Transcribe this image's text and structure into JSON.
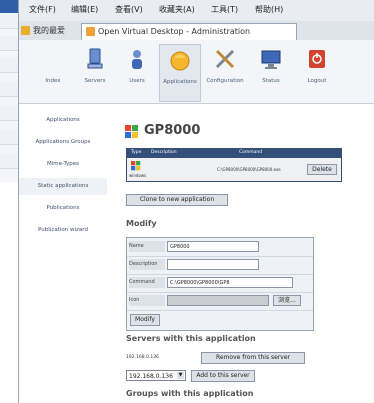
{
  "menubar": {
    "items": [
      "文件(F)",
      "编辑(E)",
      "查看(V)",
      "收藏夹(A)",
      "工具(T)",
      "帮助(H)"
    ]
  },
  "tabs": [
    {
      "label": "我的最爱",
      "active": false
    },
    {
      "label": "Open Virtual Desktop - Administration",
      "active": true
    }
  ],
  "nav": [
    {
      "label": "Index",
      "icon": "index-icon"
    },
    {
      "label": "Servers",
      "icon": "server-icon"
    },
    {
      "label": "Users",
      "icon": "users-icon"
    },
    {
      "label": "Applications",
      "icon": "applications-icon",
      "active": true
    },
    {
      "label": "Configuration",
      "icon": "tools-icon"
    },
    {
      "label": "Status",
      "icon": "monitor-icon"
    },
    {
      "label": "Logout",
      "icon": "logout-icon"
    }
  ],
  "sidebar": {
    "items": [
      {
        "label": "Applications"
      },
      {
        "label": "Applications Groups"
      },
      {
        "label": "Mime-Types"
      },
      {
        "label": "Static applications",
        "active": true
      },
      {
        "label": "Publications"
      },
      {
        "label": "Publication wizard"
      }
    ]
  },
  "app": {
    "title": "GP8000",
    "table": {
      "headers": [
        "Type",
        "Description",
        "Command"
      ],
      "row": {
        "type": "windows",
        "description": "",
        "command": "C:\\GP8000\\GP8000\\GP8000.exe"
      },
      "delete_label": "Delete"
    },
    "clone_label": "Clone to new application"
  },
  "modify": {
    "heading": "Modify",
    "fields": [
      {
        "label": "Name",
        "value": "GP8000"
      },
      {
        "label": "Description",
        "value": ""
      },
      {
        "label": "Command",
        "value": "C:\\GP8000\\GP8000\\GP8"
      },
      {
        "label": "Icon",
        "value": "",
        "browse_label": "浏览..."
      }
    ],
    "submit_label": "Modify"
  },
  "servers": {
    "heading": "Servers with this application",
    "current_server": "192.168.0.136",
    "remove_label": "Remove from this server",
    "select_value": "192.168.0.136",
    "add_label": "Add to this server"
  },
  "groups": {
    "heading": "Groups with this application"
  }
}
